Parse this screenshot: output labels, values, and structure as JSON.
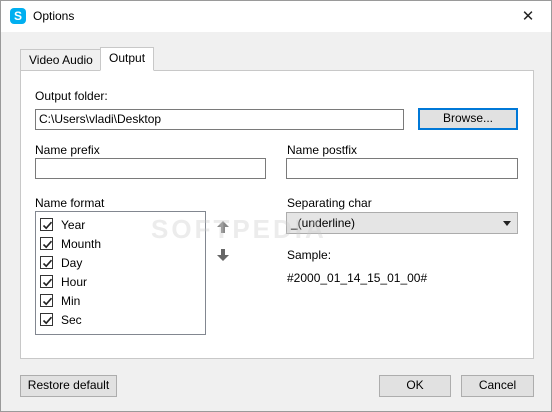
{
  "window": {
    "title": "Options",
    "app_icon_letter": "S"
  },
  "tabs": [
    {
      "label": "Video  Audio",
      "active": false
    },
    {
      "label": "Output",
      "active": true
    }
  ],
  "output": {
    "folder_label": "Output folder:",
    "folder_value": "C:\\Users\\vladi\\Desktop",
    "browse_label": "Browse...",
    "name_prefix_label": "Name prefix",
    "name_prefix_value": "",
    "name_postfix_label": "Name postfix",
    "name_postfix_value": "",
    "name_format_label": "Name format",
    "name_format_items": [
      {
        "label": "Year",
        "checked": true
      },
      {
        "label": "Mounth",
        "checked": true
      },
      {
        "label": "Day",
        "checked": true
      },
      {
        "label": "Hour",
        "checked": true
      },
      {
        "label": "Min",
        "checked": true
      },
      {
        "label": "Sec",
        "checked": true
      }
    ],
    "separating_char_label": "Separating char",
    "separating_char_value": "_(underline)",
    "sample_label": "Sample:",
    "sample_value": "#2000_01_14_15_01_00#"
  },
  "footer": {
    "restore_label": "Restore default",
    "ok_label": "OK",
    "cancel_label": "Cancel"
  },
  "watermark": "SOFTPEDIA",
  "icons": {
    "app": "skype-icon",
    "close": "close-icon",
    "move_up": "arrow-up-icon",
    "move_down": "arrow-down-icon",
    "dropdown": "chevron-down-icon",
    "check": "checkmark-icon"
  },
  "colors": {
    "app_icon": "#00aff0",
    "focus_border": "#0078d7",
    "window_bg": "#f0f0f0"
  }
}
